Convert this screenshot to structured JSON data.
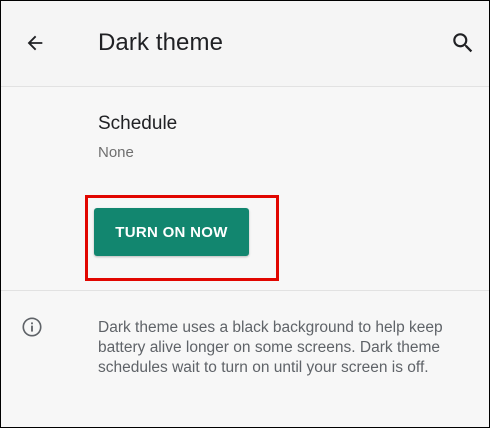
{
  "appbar": {
    "back_icon": "arrow-left-icon",
    "title": "Dark theme",
    "search_icon": "search-icon"
  },
  "schedule": {
    "title": "Schedule",
    "value": "None"
  },
  "action": {
    "turn_on_label": "TURN ON NOW"
  },
  "info": {
    "icon": "info-circle-icon",
    "text": "Dark theme uses a black background to help keep battery alive longer on some screens. Dark theme schedules wait to turn on until your screen is off."
  },
  "colors": {
    "accent": "#12866f",
    "highlight": "#e10600",
    "background": "#f7f7f7"
  }
}
